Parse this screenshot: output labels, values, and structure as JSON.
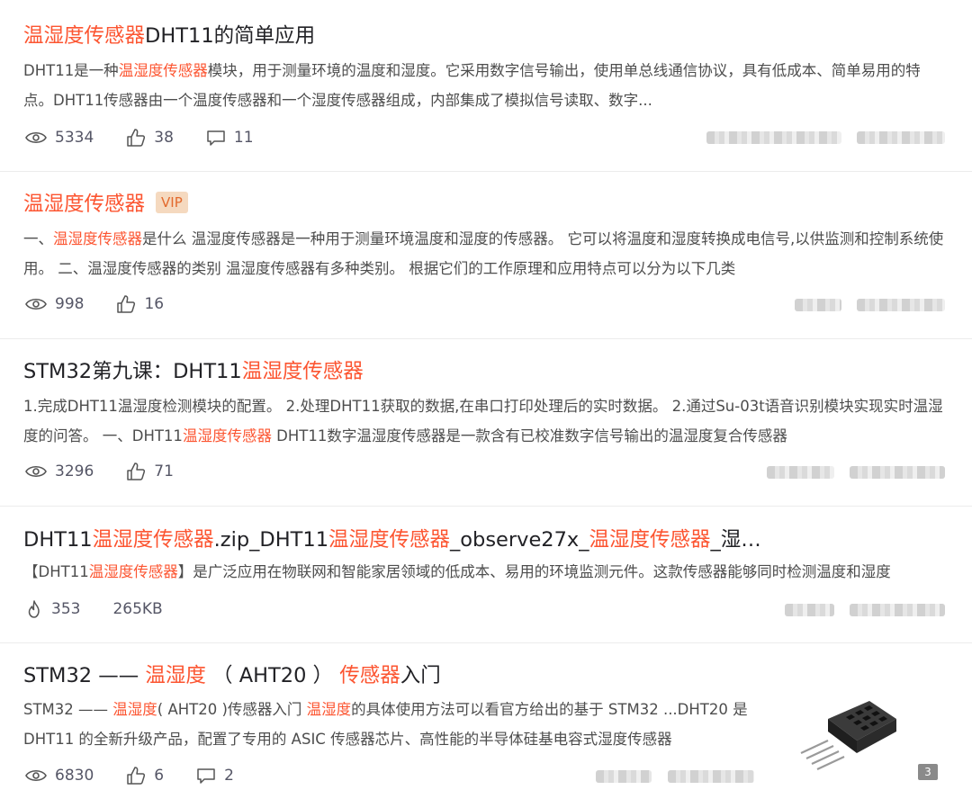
{
  "results": [
    {
      "title": [
        {
          "t": "温湿度传感器",
          "hl": true
        },
        {
          "t": "DHT11的简单应用",
          "hl": false
        }
      ],
      "desc": [
        {
          "t": "DHT11是一种",
          "hl": false
        },
        {
          "t": "温湿度传感器",
          "hl": true
        },
        {
          "t": "模块，用于测量环境的温度和湿度。它采用数字信号输出，使用单总线通信协议，具有低成本、简单易用的特点。DHT11传感器由一个温度传感器和一个湿度传感器组成，内部集成了模拟信号读取、数字...",
          "hl": false
        }
      ],
      "views": "5334",
      "likes": "38",
      "comments": "11"
    },
    {
      "title": [
        {
          "t": "温湿度传感器",
          "hl": true
        }
      ],
      "vip": "VIP",
      "desc": [
        {
          "t": "一、",
          "hl": false
        },
        {
          "t": "温湿度传感器",
          "hl": true
        },
        {
          "t": "是什么 温湿度传感器是一种用于测量环境温度和湿度的传感器。 它可以将温度和湿度转换成电信号,以供监测和控制系统使用。 二、温湿度传感器的类别 温湿度传感器有多种类别。 根据它们的工作原理和应用特点可以分为以下几类",
          "hl": false
        }
      ],
      "views": "998",
      "likes": "16"
    },
    {
      "title": [
        {
          "t": "STM32第九课：DHT11",
          "hl": false
        },
        {
          "t": "温湿度传感器",
          "hl": true
        }
      ],
      "desc": [
        {
          "t": "1.完成DHT11温湿度检测模块的配置。 2.处理DHT11获取的数据,在串口打印处理后的实时数据。 2.通过Su-03t语音识别模块实现实时温湿度的问答。 一、DHT11",
          "hl": false
        },
        {
          "t": "温湿度传感器",
          "hl": true
        },
        {
          "t": "        DHT11数字温湿度传感器是一款含有已校准数字信号输出的温湿度复合传感器",
          "hl": false
        }
      ],
      "views": "3296",
      "likes": "71"
    },
    {
      "title": [
        {
          "t": "DHT11",
          "hl": false
        },
        {
          "t": "温湿度传感器",
          "hl": true
        },
        {
          "t": ".zip_DHT11",
          "hl": false
        },
        {
          "t": "温湿度传感器",
          "hl": true
        },
        {
          "t": "_observe27x_",
          "hl": false
        },
        {
          "t": "温湿度传感器",
          "hl": true
        },
        {
          "t": "_湿…",
          "hl": false
        }
      ],
      "desc": [
        {
          "t": "【DHT11",
          "hl": false
        },
        {
          "t": "温湿度传感器",
          "hl": true
        },
        {
          "t": "】是广泛应用在物联网和智能家居领域的低成本、易用的环境监测元件。这款传感器能够同时检测温度和湿度",
          "hl": false
        }
      ],
      "hot": "353",
      "size": "265KB"
    },
    {
      "title": [
        {
          "t": "STM32 —— ",
          "hl": false
        },
        {
          "t": "温湿度",
          "hl": true
        },
        {
          "t": " （ AHT20 ） ",
          "hl": false
        },
        {
          "t": "传感器",
          "hl": true
        },
        {
          "t": "入门",
          "hl": false
        }
      ],
      "desc": [
        {
          "t": "STM32 —— ",
          "hl": false
        },
        {
          "t": "温湿度",
          "hl": true
        },
        {
          "t": "( AHT20 )传感器入门 ",
          "hl": false
        },
        {
          "t": "温湿度",
          "hl": true
        },
        {
          "t": "的具体使用方法可以看官方给出的基于 STM32 ...DHT20 是 DHT11 的全新升级产品，配置了专用的 ASIC 传感器芯片、高性能的半导体硅基电容式湿度传感器",
          "hl": false
        }
      ],
      "views": "6830",
      "likes": "6",
      "comments": "2",
      "image_count": "3"
    }
  ],
  "colors": {
    "highlight": "#fc5531",
    "vip_bg": "#f5d9bf",
    "vip_text": "#e36a2e"
  }
}
